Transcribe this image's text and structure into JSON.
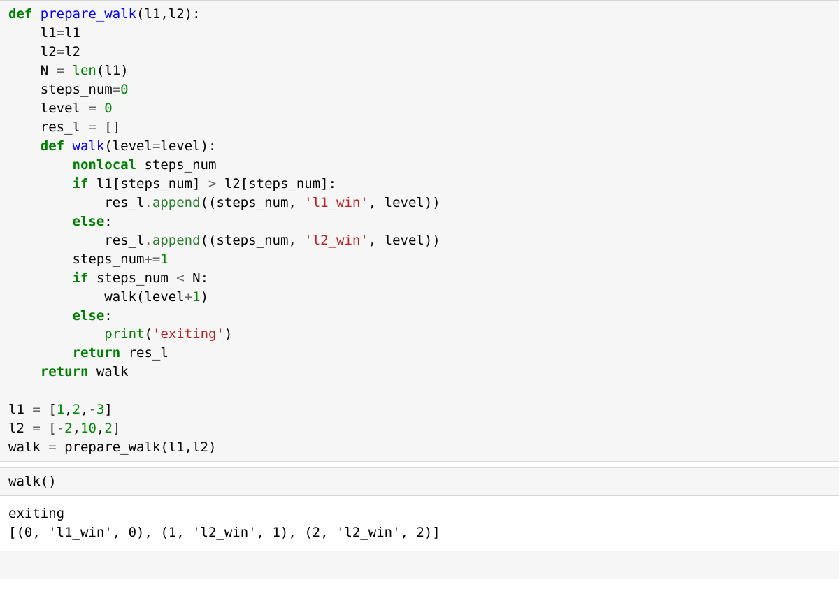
{
  "cells": [
    {
      "type": "code",
      "tokens": [
        {
          "t": "def ",
          "c": "tk-kw"
        },
        {
          "t": "prepare_walk",
          "c": "tk-def"
        },
        {
          "t": "(l1,l2):\n"
        },
        {
          "t": "    l1"
        },
        {
          "t": "=",
          "c": "tk-op"
        },
        {
          "t": "l1\n"
        },
        {
          "t": "    l2"
        },
        {
          "t": "=",
          "c": "tk-op"
        },
        {
          "t": "l2\n"
        },
        {
          "t": "    N "
        },
        {
          "t": "=",
          "c": "tk-op"
        },
        {
          "t": " "
        },
        {
          "t": "len",
          "c": "tk-builtin"
        },
        {
          "t": "(l1)\n"
        },
        {
          "t": "    steps_num"
        },
        {
          "t": "=",
          "c": "tk-op"
        },
        {
          "t": "0",
          "c": "tk-num"
        },
        {
          "t": "\n"
        },
        {
          "t": "    level "
        },
        {
          "t": "=",
          "c": "tk-op"
        },
        {
          "t": " "
        },
        {
          "t": "0",
          "c": "tk-num"
        },
        {
          "t": "\n"
        },
        {
          "t": "    res_l "
        },
        {
          "t": "=",
          "c": "tk-op"
        },
        {
          "t": " []\n"
        },
        {
          "t": "    "
        },
        {
          "t": "def ",
          "c": "tk-kw"
        },
        {
          "t": "walk",
          "c": "tk-def"
        },
        {
          "t": "(level"
        },
        {
          "t": "=",
          "c": "tk-op"
        },
        {
          "t": "level):\n"
        },
        {
          "t": "        "
        },
        {
          "t": "nonlocal",
          "c": "tk-kw"
        },
        {
          "t": " steps_num\n"
        },
        {
          "t": "        "
        },
        {
          "t": "if",
          "c": "tk-kw"
        },
        {
          "t": " l1[steps_num] "
        },
        {
          "t": ">",
          "c": "tk-op"
        },
        {
          "t": " l2[steps_num]:\n"
        },
        {
          "t": "            res_l"
        },
        {
          "t": ".",
          "c": "tk-op"
        },
        {
          "t": "append",
          "c": "tk-call"
        },
        {
          "t": "((steps_num, "
        },
        {
          "t": "'l1_win'",
          "c": "tk-str"
        },
        {
          "t": ", level))\n"
        },
        {
          "t": "        "
        },
        {
          "t": "else",
          "c": "tk-kw"
        },
        {
          "t": ":\n"
        },
        {
          "t": "            res_l"
        },
        {
          "t": ".",
          "c": "tk-op"
        },
        {
          "t": "append",
          "c": "tk-call"
        },
        {
          "t": "((steps_num, "
        },
        {
          "t": "'l2_win'",
          "c": "tk-str"
        },
        {
          "t": ", level))\n"
        },
        {
          "t": "        steps_num"
        },
        {
          "t": "+=",
          "c": "tk-op"
        },
        {
          "t": "1",
          "c": "tk-num"
        },
        {
          "t": "\n"
        },
        {
          "t": "        "
        },
        {
          "t": "if",
          "c": "tk-kw"
        },
        {
          "t": " steps_num "
        },
        {
          "t": "<",
          "c": "tk-op"
        },
        {
          "t": " N:\n"
        },
        {
          "t": "            walk(level"
        },
        {
          "t": "+",
          "c": "tk-op"
        },
        {
          "t": "1",
          "c": "tk-num"
        },
        {
          "t": ")\n"
        },
        {
          "t": "        "
        },
        {
          "t": "else",
          "c": "tk-kw"
        },
        {
          "t": ":\n"
        },
        {
          "t": "            "
        },
        {
          "t": "print",
          "c": "tk-builtin"
        },
        {
          "t": "("
        },
        {
          "t": "'exiting'",
          "c": "tk-str"
        },
        {
          "t": ")\n"
        },
        {
          "t": "        "
        },
        {
          "t": "return",
          "c": "tk-kw"
        },
        {
          "t": " res_l\n"
        },
        {
          "t": "    "
        },
        {
          "t": "return",
          "c": "tk-kw"
        },
        {
          "t": " walk\n"
        },
        {
          "t": "\n"
        },
        {
          "t": "l1 "
        },
        {
          "t": "=",
          "c": "tk-op"
        },
        {
          "t": " ["
        },
        {
          "t": "1",
          "c": "tk-num"
        },
        {
          "t": ","
        },
        {
          "t": "2",
          "c": "tk-num"
        },
        {
          "t": ","
        },
        {
          "t": "-",
          "c": "tk-op"
        },
        {
          "t": "3",
          "c": "tk-num"
        },
        {
          "t": "]\n"
        },
        {
          "t": "l2 "
        },
        {
          "t": "=",
          "c": "tk-op"
        },
        {
          "t": " ["
        },
        {
          "t": "-",
          "c": "tk-op"
        },
        {
          "t": "2",
          "c": "tk-num"
        },
        {
          "t": ","
        },
        {
          "t": "10",
          "c": "tk-num"
        },
        {
          "t": ","
        },
        {
          "t": "2",
          "c": "tk-num"
        },
        {
          "t": "]\n"
        },
        {
          "t": "walk "
        },
        {
          "t": "=",
          "c": "tk-op"
        },
        {
          "t": " prepare_walk(l1,l2)"
        }
      ]
    },
    {
      "type": "code",
      "tokens": [
        {
          "t": "walk()"
        }
      ]
    },
    {
      "type": "output",
      "text": "exiting\n[(0, 'l1_win', 0), (1, 'l2_win', 1), (2, 'l2_win', 2)]"
    },
    {
      "type": "code",
      "tokens": [
        {
          "t": " "
        }
      ]
    }
  ]
}
